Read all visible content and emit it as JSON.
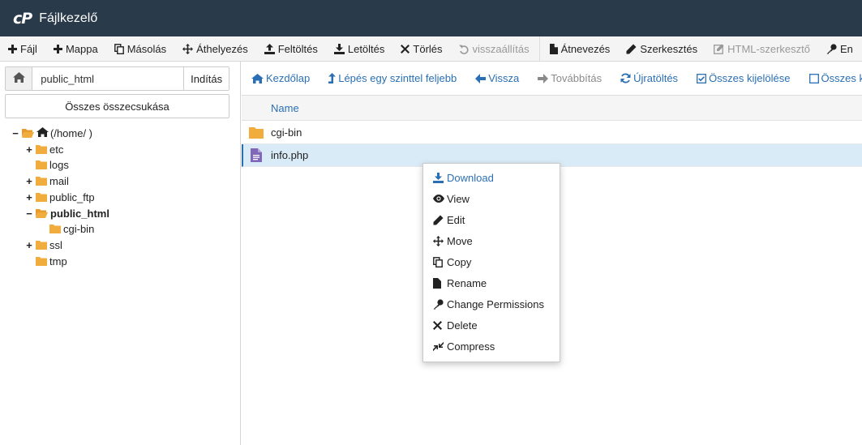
{
  "header": {
    "logo": "cP",
    "title": "Fájlkezelő"
  },
  "toolbar": {
    "items": [
      {
        "label": "Fájl",
        "icon": "plus-icon"
      },
      {
        "label": "Mappa",
        "icon": "plus-icon"
      },
      {
        "label": "Másolás",
        "icon": "copy-icon"
      },
      {
        "label": "Áthelyezés",
        "icon": "move-icon"
      },
      {
        "label": "Feltöltés",
        "icon": "upload-icon"
      },
      {
        "label": "Letöltés",
        "icon": "download-icon"
      },
      {
        "label": "Törlés",
        "icon": "close-icon"
      },
      {
        "label": "visszaállítás",
        "icon": "undo-icon",
        "disabled": true
      },
      {
        "label": "Átnevezés",
        "icon": "file-icon"
      },
      {
        "label": "Szerkesztés",
        "icon": "pencil-icon"
      },
      {
        "label": "HTML-szerkesztő",
        "icon": "html-edit-icon",
        "disabled": true
      },
      {
        "label": "En",
        "icon": "key-icon"
      }
    ]
  },
  "left_panel": {
    "path_value": "public_html",
    "go_label": "Indítás",
    "collapse_label": "Összes összecsukása",
    "tree": {
      "root_label": "(/home/        )",
      "items": [
        {
          "label": "etc",
          "toggle": "+"
        },
        {
          "label": "logs",
          "toggle": ""
        },
        {
          "label": "mail",
          "toggle": "+"
        },
        {
          "label": "public_ftp",
          "toggle": "+"
        },
        {
          "label": "public_html",
          "toggle": "−",
          "open": true,
          "active": true
        },
        {
          "label": "cgi-bin",
          "toggle": "",
          "child": true
        },
        {
          "label": "ssl",
          "toggle": "+"
        },
        {
          "label": "tmp",
          "toggle": ""
        }
      ]
    }
  },
  "nav": {
    "items": [
      {
        "label": "Kezdőlap",
        "icon": "home-icon"
      },
      {
        "label": "Lépés egy szinttel feljebb",
        "icon": "level-up-icon"
      },
      {
        "label": "Vissza",
        "icon": "arrow-left-icon"
      },
      {
        "label": "Továbbítás",
        "icon": "arrow-right-icon",
        "disabled": true
      },
      {
        "label": "Újratöltés",
        "icon": "refresh-icon"
      },
      {
        "label": "Összes kijelölése",
        "icon": "checkbox-checked-icon"
      },
      {
        "label": "Összes kije",
        "icon": "checkbox-empty-icon"
      }
    ]
  },
  "file_table": {
    "column_name": "Name",
    "rows": [
      {
        "name": "cgi-bin",
        "type": "folder"
      },
      {
        "name": "info.php",
        "type": "file",
        "selected": true
      }
    ]
  },
  "context_menu": {
    "items": [
      {
        "label": "Download",
        "icon": "download-icon"
      },
      {
        "label": "View",
        "icon": "eye-icon"
      },
      {
        "label": "Edit",
        "icon": "pencil-icon"
      },
      {
        "label": "Move",
        "icon": "move-icon"
      },
      {
        "label": "Copy",
        "icon": "copy-icon"
      },
      {
        "label": "Rename",
        "icon": "file-icon"
      },
      {
        "label": "Change Permissions",
        "icon": "key-icon"
      },
      {
        "label": "Delete",
        "icon": "close-icon"
      },
      {
        "label": "Compress",
        "icon": "compress-icon"
      }
    ]
  },
  "colors": {
    "header_bg": "#293a4a",
    "link_blue": "#2a6fb3",
    "folder_orange": "#f0ad3e",
    "selected_row": "#d9ebf6"
  }
}
